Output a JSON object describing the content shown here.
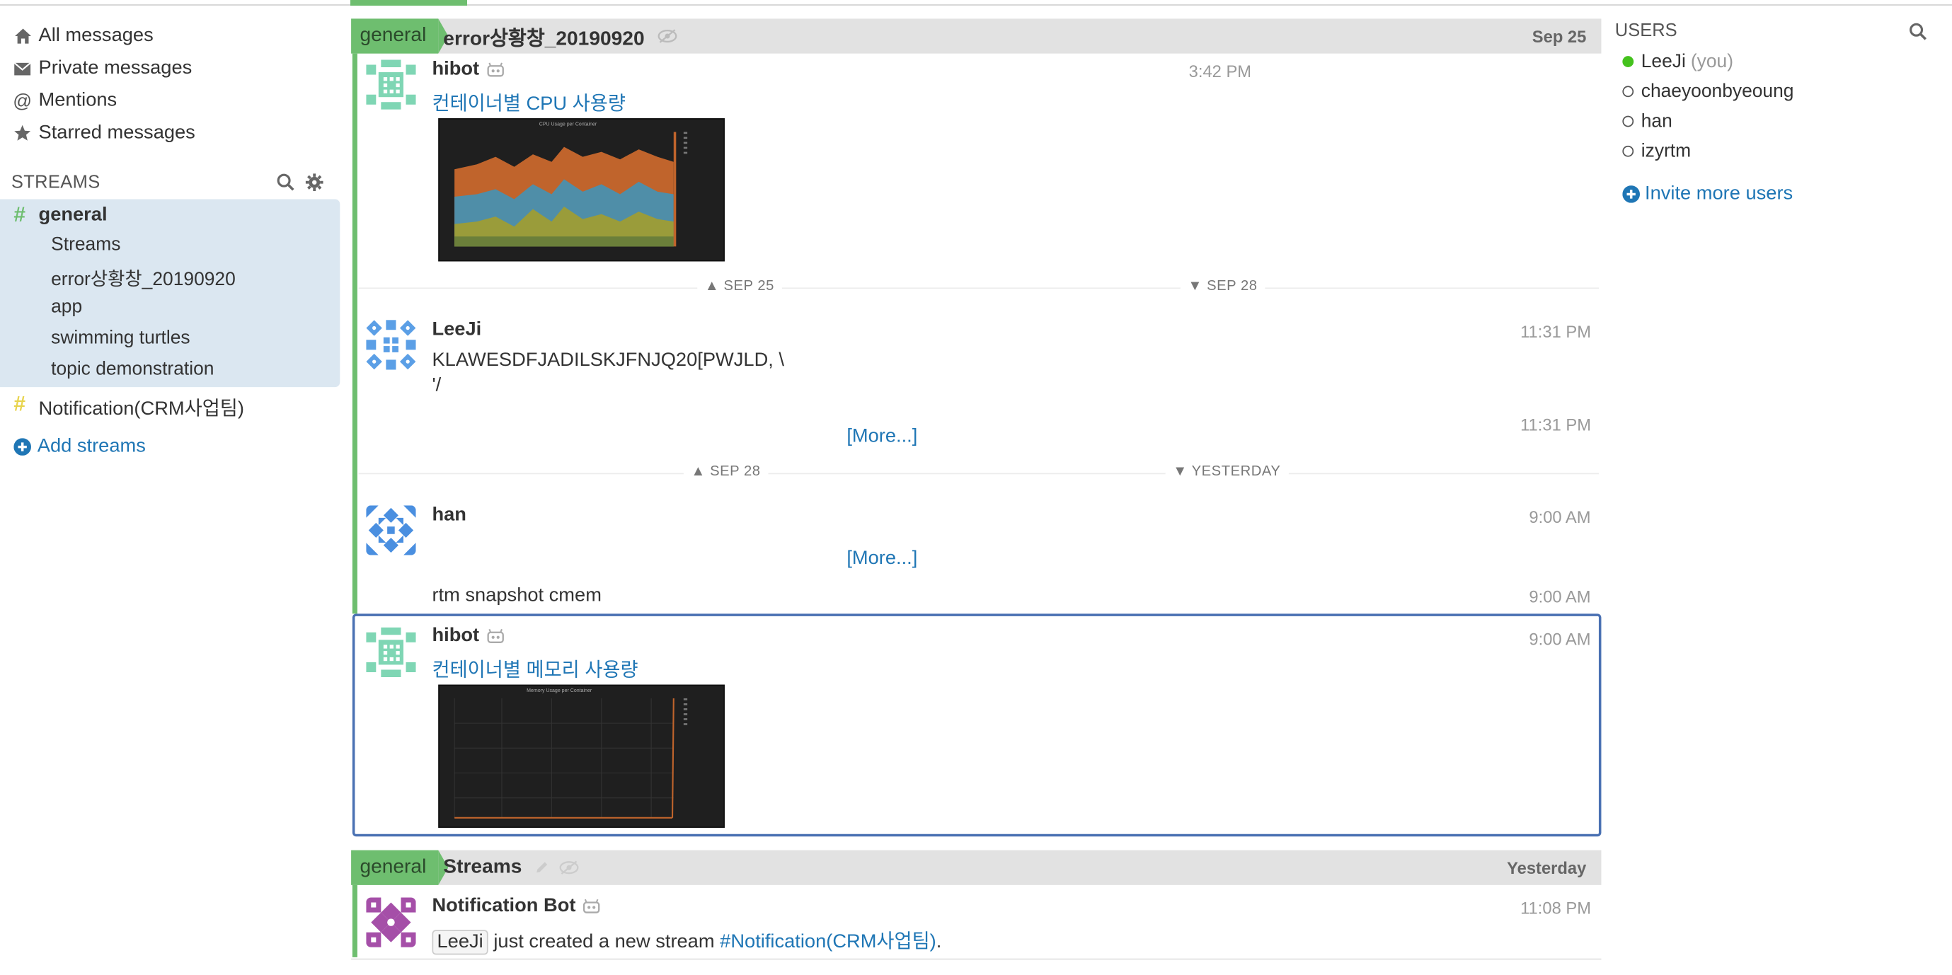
{
  "nav": {
    "all_messages": "All messages",
    "private_messages": "Private messages",
    "mentions": "Mentions",
    "starred_messages": "Starred messages"
  },
  "streams": {
    "header": "STREAMS",
    "general": {
      "name": "general",
      "color": "#6ebe6f",
      "topics": [
        "Streams",
        "error상황창_20190920",
        "app",
        "swimming turtles",
        "topic demonstration"
      ]
    },
    "notification": {
      "name": "Notification(CRM사업팀)",
      "color": "#e8d44d"
    },
    "add_streams": "Add streams"
  },
  "recipients": [
    {
      "stream": "general",
      "topic": "error상황창_20190920",
      "date": "Sep 25"
    },
    {
      "stream": "general",
      "topic": "Streams",
      "date": "Yesterday"
    }
  ],
  "messages": [
    {
      "sender": "hibot",
      "time": "3:42 PM",
      "text": "컨테이너별 CPU 사용량",
      "image_caption": "CPU Usage per Container"
    },
    {
      "sender": "LeeJi",
      "time": "11:31 PM",
      "text_line1": "KLAWESDFJADILSKJFNJQ20[PWJLD, \\",
      "text_line2": "'/"
    },
    {
      "time": "11:31 PM",
      "more": "[More...]"
    },
    {
      "sender": "han",
      "time": "9:00 AM",
      "more": "[More...]"
    },
    {
      "time": "9:00 AM",
      "text": "rtm snapshot cmem"
    },
    {
      "sender": "hibot",
      "time": "9:00 AM",
      "text": "컨테이너별 메모리 사용량",
      "image_caption": "Memory Usage per Container"
    },
    {
      "sender": "Notification Bot",
      "time": "11:08 PM",
      "mention": "LeeJi",
      "text": "just created a new stream",
      "stream_link": "#Notification(CRM사업팀)",
      "tail": "."
    }
  ],
  "date_dividers": [
    {
      "left": "SEP 25",
      "right": "SEP 28"
    },
    {
      "left": "SEP 28",
      "right": "YESTERDAY"
    }
  ],
  "users": {
    "header": "USERS",
    "list": [
      {
        "name": "LeeJi",
        "suffix": "(you)",
        "active": true
      },
      {
        "name": "chaeyoonbyeoung",
        "active": false
      },
      {
        "name": "han",
        "active": false
      },
      {
        "name": "izyrtm",
        "active": false
      }
    ],
    "invite": "Invite more users"
  }
}
